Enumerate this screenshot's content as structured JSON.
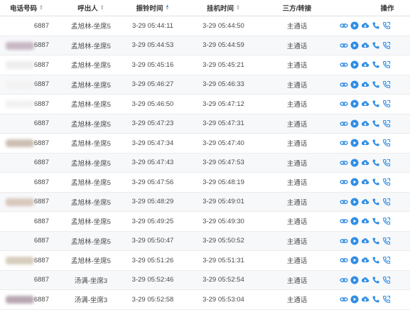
{
  "headers": {
    "phone": "电话号码",
    "caller": "呼出人",
    "ring": "振铃时间",
    "hang": "挂机时间",
    "type": "三方/转接",
    "ops": "操作"
  },
  "icons": [
    "link-icon",
    "play-icon",
    "cloud-download-icon",
    "phone-icon",
    "phone-transfer-icon"
  ],
  "colors": {
    "accent": "#2f8de4",
    "row_alt": "#f7f8fa"
  },
  "rows": [
    {
      "phone": "6887",
      "caller": "孟旭林-坐席5",
      "ring": "3-29 05:44:11",
      "hang": "3-29 05:44:50",
      "type": "主通话"
    },
    {
      "phone": "6887",
      "caller": "孟旭林-坐席5",
      "ring": "3-29 05:44:53",
      "hang": "3-29 05:44:59",
      "type": "主通话"
    },
    {
      "phone": "6887",
      "caller": "孟旭林-坐席5",
      "ring": "3-29 05:45:16",
      "hang": "3-29 05:45:21",
      "type": "主通话"
    },
    {
      "phone": "6887",
      "caller": "孟旭林-坐席5",
      "ring": "3-29 05:46:27",
      "hang": "3-29 05:46:33",
      "type": "主通话"
    },
    {
      "phone": "6887",
      "caller": "孟旭林-坐席5",
      "ring": "3-29 05:46:50",
      "hang": "3-29 05:47:12",
      "type": "主通话"
    },
    {
      "phone": "6887",
      "caller": "孟旭林-坐席5",
      "ring": "3-29 05:47:23",
      "hang": "3-29 05:47:31",
      "type": "主通话"
    },
    {
      "phone": "6887",
      "caller": "孟旭林-坐席5",
      "ring": "3-29 05:47:34",
      "hang": "3-29 05:47:40",
      "type": "主通话"
    },
    {
      "phone": "6887",
      "caller": "孟旭林-坐席5",
      "ring": "3-29 05:47:43",
      "hang": "3-29 05:47:53",
      "type": "主通话"
    },
    {
      "phone": "6887",
      "caller": "孟旭林-坐席5",
      "ring": "3-29 05:47:56",
      "hang": "3-29 05:48:19",
      "type": "主通话"
    },
    {
      "phone": "6887",
      "caller": "孟旭林-坐席5",
      "ring": "3-29 05:48:29",
      "hang": "3-29 05:49:01",
      "type": "主通话"
    },
    {
      "phone": "6887",
      "caller": "孟旭林-坐席5",
      "ring": "3-29 05:49:25",
      "hang": "3-29 05:49:30",
      "type": "主通话"
    },
    {
      "phone": "6887",
      "caller": "孟旭林-坐席5",
      "ring": "3-29 05:50:47",
      "hang": "3-29 05:50:52",
      "type": "主通话"
    },
    {
      "phone": "6887",
      "caller": "孟旭林-坐席5",
      "ring": "3-29 05:51:26",
      "hang": "3-29 05:51:31",
      "type": "主通话"
    },
    {
      "phone": "6887",
      "caller": "汤满-坐席3",
      "ring": "3-29 05:52:46",
      "hang": "3-29 05:52:54",
      "type": "主通话"
    },
    {
      "phone": "6887",
      "caller": "汤满-坐席3",
      "ring": "3-29 05:52:58",
      "hang": "3-29 05:53:04",
      "type": "主通话"
    }
  ]
}
